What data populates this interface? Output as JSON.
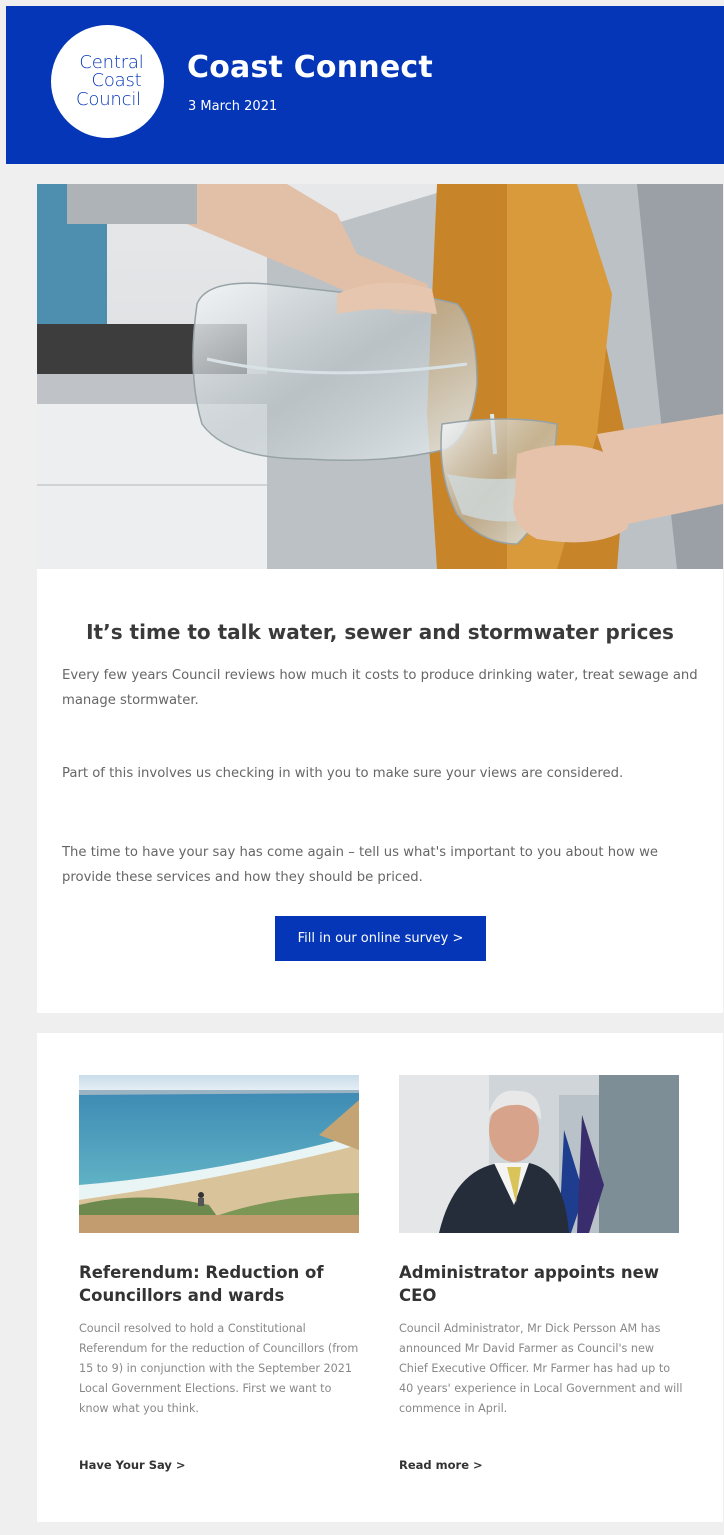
{
  "header": {
    "logo_lines": [
      "Central",
      "Coast",
      "Council"
    ],
    "title": "Coast Connect",
    "date": "3 March 2021",
    "background": "#0436b7"
  },
  "feature": {
    "heading": "It’s time to talk water, sewer and stormwater prices",
    "paragraphs": [
      "Every few years Council reviews how much it costs to produce drinking water, treat sewage and manage stormwater.",
      "Part of this involves us checking in with you to make sure your views are considered.",
      "The time to have your say has come again – tell us what's important to you about how we provide these services and how they should be priced."
    ],
    "cta_label": "Fill in our online survey >"
  },
  "articles": [
    {
      "title": "Referendum: Reduction of Councillors and wards",
      "body": "Council resolved to hold a Constitutional Referendum for the reduction of Councillors (from 15 to 9) in conjunction with the September 2021 Local Government Elections. First we want to know what you think.",
      "link": "Have Your Say >"
    },
    {
      "title": "Administrator appoints new CEO",
      "body": "Council Administrator, Mr Dick Persson AM has announced Mr David Farmer as Council's new Chief Executive Officer. Mr Farmer has had up to 40 years' experience in Local Government and will commence in April.",
      "link": "Read more >"
    }
  ]
}
